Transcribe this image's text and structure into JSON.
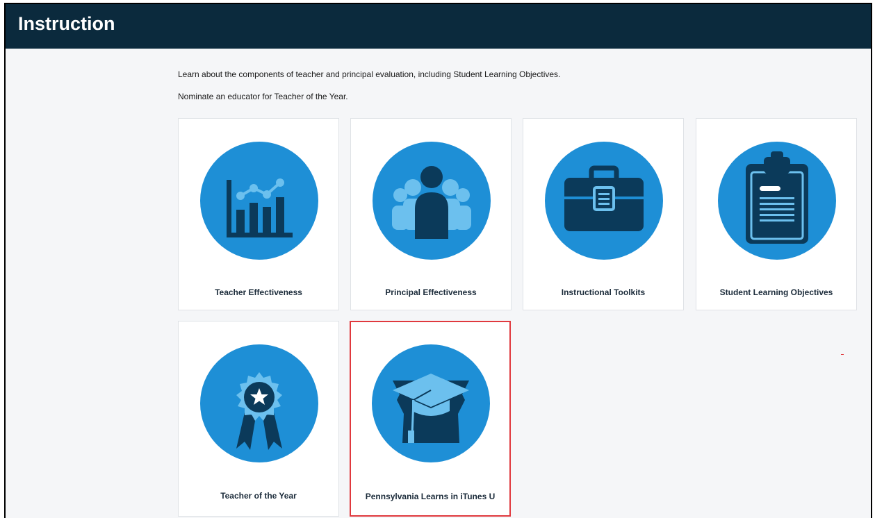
{
  "header": {
    "title": "Instruction"
  },
  "intro": {
    "line1": "Learn about the components of teacher and principal evaluation, including Student Learning Objectives.",
    "line2": "Nominate an educator for Teacher of the Year."
  },
  "cards": [
    {
      "label": "Teacher Effectiveness",
      "icon": "bar-chart-icon"
    },
    {
      "label": "Principal Effectiveness",
      "icon": "people-icon"
    },
    {
      "label": "Instructional Toolkits",
      "icon": "briefcase-icon"
    },
    {
      "label": "Student Learning Objectives",
      "icon": "clipboard-icon"
    },
    {
      "label": "Teacher of the Year",
      "icon": "award-ribbon-icon"
    },
    {
      "label": "Pennsylvania Learns in iTunes U",
      "icon": "graduation-cap-keystone-icon",
      "selected": true
    }
  ],
  "colors": {
    "header": "#0b2a3d",
    "circle": "#1e8fd6",
    "icon_dark": "#0b3a5a",
    "icon_light": "#6cc0ee",
    "highlight": "#e0393e"
  }
}
